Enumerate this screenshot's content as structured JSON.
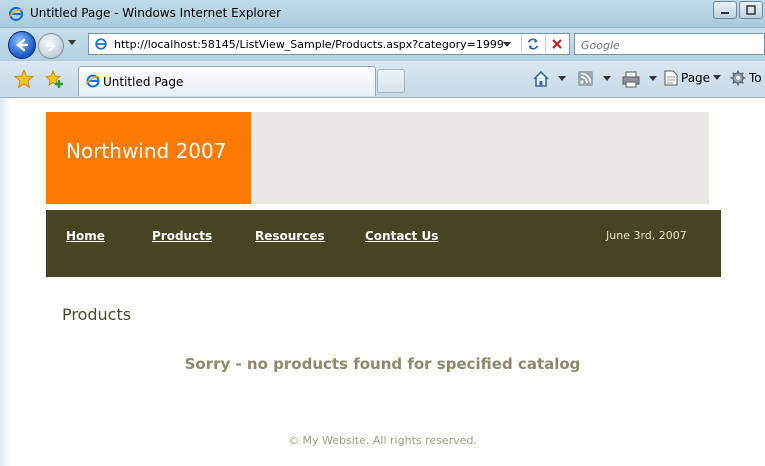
{
  "window": {
    "title": "Untitled Page - Windows Internet Explorer"
  },
  "address_bar": {
    "url": "http://localhost:58145/ListView_Sample/Products.aspx?category=1999"
  },
  "search": {
    "placeholder": "Google"
  },
  "tabs": [
    {
      "label": "Untitled Page"
    }
  ],
  "command_bar": {
    "page_label": "Page",
    "tools_label": "To"
  },
  "site": {
    "title": "Northwind 2007",
    "nav": [
      {
        "label": "Home"
      },
      {
        "label": "Products"
      },
      {
        "label": "Resources"
      },
      {
        "label": "Contact Us"
      }
    ],
    "date": "June 3rd, 2007",
    "heading": "Products",
    "empty_message": "Sorry - no products found for specified catalog",
    "footer": "© My Website. All rights reserved."
  },
  "colors": {
    "header_orange": "#ff7a00",
    "nav_bar": "#474521",
    "header_fill": "#e8e7e1"
  },
  "icons": [
    "ie-icon",
    "back-arrow-icon",
    "forward-arrow-icon",
    "refresh-icon",
    "stop-icon",
    "favorites-star-icon",
    "add-favorites-icon",
    "home-icon",
    "feeds-icon",
    "print-icon",
    "page-icon",
    "tools-gear-icon"
  ]
}
